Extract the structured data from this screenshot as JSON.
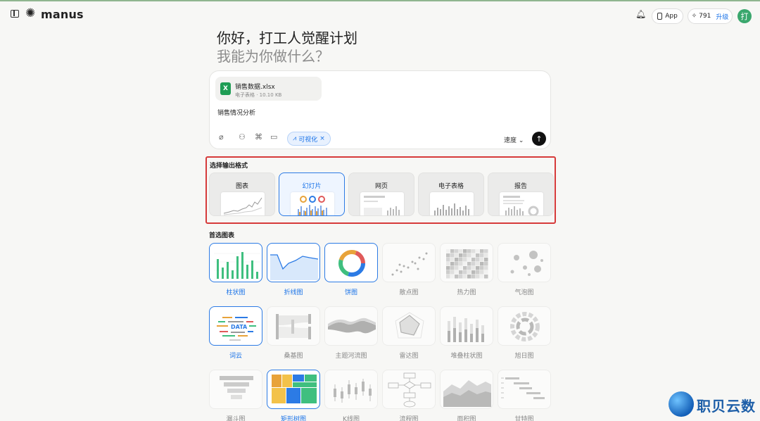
{
  "header": {
    "logo_text": "manus",
    "app_label": "App",
    "credits": "791",
    "upgrade_label": "升级",
    "avatar_text": "打"
  },
  "greeting": {
    "line1": "你好，打工人觉醒计划",
    "line2": "我能为你做什么？"
  },
  "composer": {
    "file_name": "销售数据.xlsx",
    "file_meta": "电子表格 · 10.10 KB",
    "file_icon": "X",
    "prompt": "销售情况分析",
    "tag_label": "可视化",
    "speed_label": "速度"
  },
  "output_format": {
    "title": "选择输出格式",
    "options": [
      {
        "label": "图表",
        "selected": false
      },
      {
        "label": "幻灯片",
        "selected": true
      },
      {
        "label": "网页",
        "selected": false
      },
      {
        "label": "电子表格",
        "selected": false
      },
      {
        "label": "报告",
        "selected": false
      }
    ]
  },
  "preferred_charts": {
    "title": "首选图表",
    "items": [
      {
        "label": "柱状图",
        "selected": true
      },
      {
        "label": "折线图",
        "selected": true
      },
      {
        "label": "饼图",
        "selected": true
      },
      {
        "label": "散点图",
        "selected": false
      },
      {
        "label": "热力图",
        "selected": false
      },
      {
        "label": "气泡图",
        "selected": false
      },
      {
        "label": "词云",
        "selected": true
      },
      {
        "label": "桑基图",
        "selected": false
      },
      {
        "label": "主题河流图",
        "selected": false
      },
      {
        "label": "雷达图",
        "selected": false
      },
      {
        "label": "堆叠柱状图",
        "selected": false
      },
      {
        "label": "旭日图",
        "selected": false
      },
      {
        "label": "漏斗图",
        "selected": false
      },
      {
        "label": "矩形树图",
        "selected": true
      },
      {
        "label": "K线图",
        "selected": false
      },
      {
        "label": "流程图",
        "selected": false
      },
      {
        "label": "面积图",
        "selected": false
      },
      {
        "label": "甘特图",
        "selected": false
      }
    ]
  },
  "wordcloud": {
    "center_word": "DATA"
  },
  "watermark": {
    "text": "职贝云数"
  },
  "colors": {
    "accent": "#2c7be5",
    "highlight_box": "#d63a3a",
    "excel_green": "#1f9d55",
    "avatar": "#3aa76d"
  }
}
